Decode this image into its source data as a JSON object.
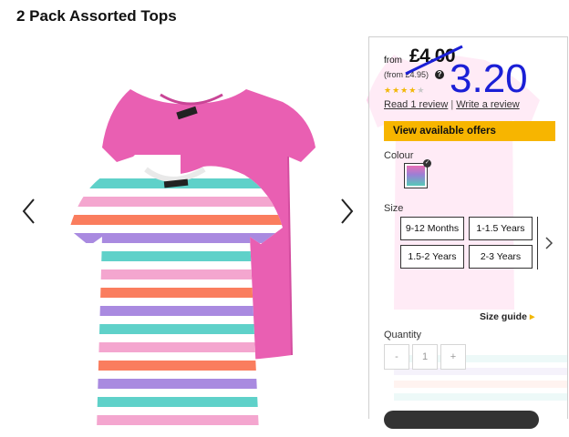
{
  "product": {
    "title": "2 Pack Assorted Tops"
  },
  "gallery": {
    "prev_icon": "chevron-left-icon",
    "next_icon": "chevron-right-icon",
    "image": "pink-and-striped-tops"
  },
  "pricing": {
    "from_label": "from",
    "price": "£4.00",
    "was_price": "(from £4.95)",
    "info_icon": "?",
    "overlay_price": "3.20",
    "overlay_color": "#1a1fd6"
  },
  "rating": {
    "stars": 4,
    "max_stars": 5
  },
  "reviews": {
    "read_label": "Read 1 review",
    "separator": "|",
    "write_label": "Write a review"
  },
  "offers": {
    "button_label": "View available offers",
    "button_color": "#f7b500"
  },
  "colour": {
    "label": "Colour",
    "selected_swatch": "multi-pink-purple-teal"
  },
  "size": {
    "label": "Size",
    "options": [
      "9-12 Months",
      "1-1.5 Years",
      "1.5-2 Years",
      "2-3 Years"
    ],
    "next_icon": "chevron-right-icon",
    "guide_label": "Size guide",
    "guide_caret": "▸"
  },
  "quantity": {
    "label": "Quantity",
    "minus": "-",
    "value": "1",
    "plus": "+"
  }
}
